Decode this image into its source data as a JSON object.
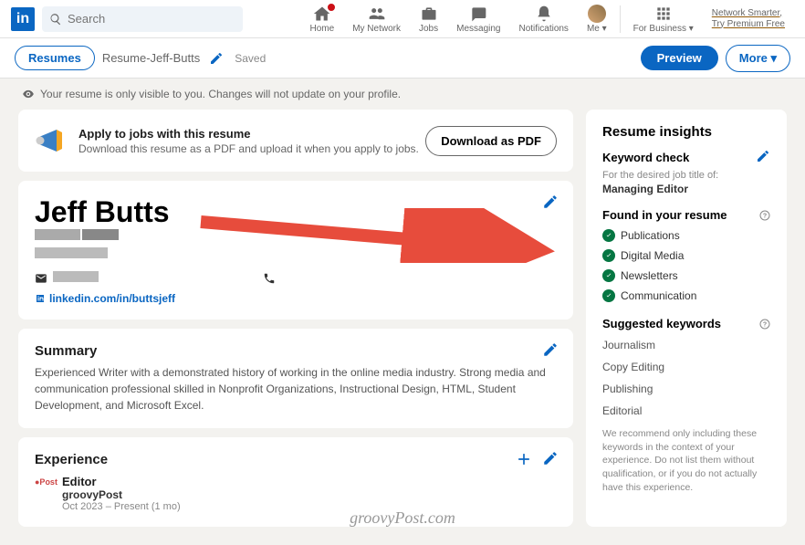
{
  "nav": {
    "logo_text": "in",
    "search_placeholder": "Search",
    "items": [
      {
        "label": "Home"
      },
      {
        "label": "My Network"
      },
      {
        "label": "Jobs"
      },
      {
        "label": "Messaging"
      },
      {
        "label": "Notifications"
      },
      {
        "label": "Me ▾"
      },
      {
        "label": "For Business ▾"
      }
    ],
    "premium_line1": "Network Smarter,",
    "premium_line2": "Try Premium Free"
  },
  "crumb": {
    "pill": "Resumes",
    "name": "Resume-Jeff-Butts",
    "status": "Saved",
    "preview": "Preview",
    "more": "More ▾"
  },
  "notice": "Your resume is only visible to you. Changes will not update on your profile.",
  "apply": {
    "title": "Apply to jobs with this resume",
    "subtitle": "Download this resume as a PDF and upload it when you apply to jobs.",
    "button": "Download as PDF"
  },
  "profile": {
    "name": "Jeff Butts",
    "url_text": "linkedin.com/in/buttsjeff"
  },
  "summary": {
    "title": "Summary",
    "body": "Experienced Writer with a demonstrated history of working in the online media industry. Strong media and communication professional skilled in Nonprofit Organizations, Instructional Design, HTML, Student Development, and Microsoft Excel."
  },
  "experience": {
    "title": "Experience",
    "item": {
      "role": "Editor",
      "company": "groovyPost",
      "dates": "Oct 2023 – Present (1 mo)"
    }
  },
  "insights": {
    "title": "Resume insights",
    "keyword_check": "Keyword check",
    "desired_sub": "For the desired job title of:",
    "job_title": "Managing Editor",
    "found_title": "Found in your resume",
    "found": [
      "Publications",
      "Digital Media",
      "Newsletters",
      "Communication"
    ],
    "suggested_title": "Suggested keywords",
    "suggested": [
      "Journalism",
      "Copy Editing",
      "Publishing",
      "Editorial"
    ],
    "hint": "We recommend only including these keywords in the context of your experience. Do not list them without qualification, or if you do not actually have this experience."
  },
  "watermark": "groovyPost.com"
}
